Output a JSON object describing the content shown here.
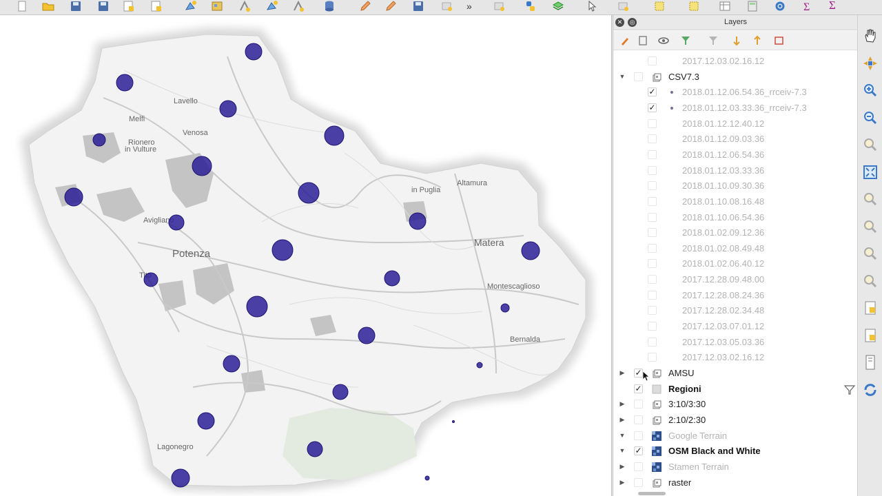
{
  "toolbar": {
    "icons": [
      "new-project-icon",
      "open-project-icon",
      "save-project-icon",
      "save-as-icon",
      "new-print-layout-icon",
      "layout-manager-icon",
      "add-vector-layer-icon",
      "add-raster-layer-icon",
      "digitize-icon",
      "new-shapefile-icon",
      "add-delimited-text-icon",
      "add-database-icon",
      "edit-pencil-icon",
      "toggle-editing-icon",
      "save-edits-icon",
      "add-feature-icon",
      "more-tools-icon",
      "copy-features-icon",
      "python-icon",
      "add-plugin-icon",
      "identify-icon",
      "select-features-icon",
      "select-by-value-icon",
      "deselect-icon",
      "attribute-table-icon",
      "field-calculator-icon",
      "processing-toolbox-icon",
      "statistics-icon"
    ],
    "more_glyph": "»",
    "sigma_glyph": "Σ"
  },
  "map": {
    "labels": [
      {
        "key": "lavello",
        "text": "Lavello"
      },
      {
        "key": "melfi",
        "text": "Melfi"
      },
      {
        "key": "venosa",
        "text": "Venosa"
      },
      {
        "key": "rionero1",
        "text": "Rionero"
      },
      {
        "key": "rionero2",
        "text": "in Vulture"
      },
      {
        "key": "gravina",
        "text": "in Puglia"
      },
      {
        "key": "altamura",
        "text": "Altamura"
      },
      {
        "key": "matera",
        "text": "Matera"
      },
      {
        "key": "avigliano",
        "text": "Avigliano"
      },
      {
        "key": "potenza",
        "text": "Potenza"
      },
      {
        "key": "tito",
        "text": "Tito"
      },
      {
        "key": "montescaglioso",
        "text": "Montescaglioso"
      },
      {
        "key": "bernalda",
        "text": "Bernalda"
      },
      {
        "key": "lagonegro",
        "text": "Lagonegro"
      }
    ],
    "point_color": "#2a1f96"
  },
  "layers_panel": {
    "title": "Layers",
    "tools": [
      "style-brush-icon",
      "add-group-icon",
      "manage-visibility-icon",
      "filter-legend-icon",
      "filter-expression-icon",
      "expand-all-icon",
      "collapse-all-icon",
      "remove-layer-icon"
    ],
    "rows": [
      {
        "label": "2017.12.03.02.16.12",
        "level": 2,
        "style": "dim",
        "checked": false,
        "arrow": "",
        "icon": "",
        "dot": false
      },
      {
        "label": "CSV7.3",
        "level": 1,
        "style": "normal",
        "checked": false,
        "arrow": "▼",
        "icon": "group",
        "dot": false
      },
      {
        "label": "2018.01.12.06.54.36_rrceiv-7.3",
        "level": 2,
        "style": "dim",
        "checked": true,
        "arrow": "",
        "icon": "",
        "dot": true
      },
      {
        "label": "2018.01.12.03.33.36_rrceiv-7.3",
        "level": 2,
        "style": "dim",
        "checked": true,
        "arrow": "",
        "icon": "",
        "dot": true
      },
      {
        "label": "2018.01.12.12.40.12",
        "level": 2,
        "style": "dim",
        "checked": false,
        "arrow": "",
        "icon": "",
        "dot": false
      },
      {
        "label": "2018.01.12.09.03.36",
        "level": 2,
        "style": "dim",
        "checked": false,
        "arrow": "",
        "icon": "",
        "dot": false
      },
      {
        "label": "2018.01.12.06.54.36",
        "level": 2,
        "style": "dim",
        "checked": false,
        "arrow": "",
        "icon": "",
        "dot": false
      },
      {
        "label": "2018.01.12.03.33.36",
        "level": 2,
        "style": "dim",
        "checked": false,
        "arrow": "",
        "icon": "",
        "dot": false
      },
      {
        "label": "2018.01.10.09.30.36",
        "level": 2,
        "style": "dim",
        "checked": false,
        "arrow": "",
        "icon": "",
        "dot": false
      },
      {
        "label": "2018.01.10.08.16.48",
        "level": 2,
        "style": "dim",
        "checked": false,
        "arrow": "",
        "icon": "",
        "dot": false
      },
      {
        "label": "2018.01.10.06.54.36",
        "level": 2,
        "style": "dim",
        "checked": false,
        "arrow": "",
        "icon": "",
        "dot": false
      },
      {
        "label": "2018.01.02.09.12.36",
        "level": 2,
        "style": "dim",
        "checked": false,
        "arrow": "",
        "icon": "",
        "dot": false
      },
      {
        "label": "2018.01.02.08.49.48",
        "level": 2,
        "style": "dim",
        "checked": false,
        "arrow": "",
        "icon": "",
        "dot": false
      },
      {
        "label": "2018.01.02.06.40.12",
        "level": 2,
        "style": "dim",
        "checked": false,
        "arrow": "",
        "icon": "",
        "dot": false
      },
      {
        "label": "2017.12.28.09.48.00",
        "level": 2,
        "style": "dim",
        "checked": false,
        "arrow": "",
        "icon": "",
        "dot": false
      },
      {
        "label": "2017.12.28.08.24.36",
        "level": 2,
        "style": "dim",
        "checked": false,
        "arrow": "",
        "icon": "",
        "dot": false
      },
      {
        "label": "2017.12.28.02.34.48",
        "level": 2,
        "style": "dim",
        "checked": false,
        "arrow": "",
        "icon": "",
        "dot": false
      },
      {
        "label": "2017.12.03.07.01.12",
        "level": 2,
        "style": "dim",
        "checked": false,
        "arrow": "",
        "icon": "",
        "dot": false
      },
      {
        "label": "2017.12.03.05.03.36",
        "level": 2,
        "style": "dim",
        "checked": false,
        "arrow": "",
        "icon": "",
        "dot": false
      },
      {
        "label": "2017.12.03.02.16.12",
        "level": 2,
        "style": "dim",
        "checked": false,
        "arrow": "",
        "icon": "",
        "dot": false
      },
      {
        "label": "AMSU",
        "level": 1,
        "style": "normal",
        "checked": true,
        "arrow": "▶",
        "icon": "group",
        "dot": false
      },
      {
        "label": "Regioni",
        "level": 1,
        "style": "bold",
        "checked": true,
        "arrow": "",
        "icon": "polygon",
        "dot": false
      },
      {
        "label": "3:10/3:30",
        "level": 1,
        "style": "normal",
        "checked": false,
        "arrow": "▶",
        "icon": "group",
        "dot": false
      },
      {
        "label": "2:10/2:30",
        "level": 1,
        "style": "normal",
        "checked": false,
        "arrow": "▶",
        "icon": "group",
        "dot": false
      },
      {
        "label": "Google Terrain",
        "level": 1,
        "style": "dim",
        "checked": false,
        "arrow": "▼",
        "icon": "raster",
        "dot": false
      },
      {
        "label": "OSM Black and White",
        "level": 1,
        "style": "bold",
        "checked": true,
        "arrow": "▼",
        "icon": "raster",
        "dot": false
      },
      {
        "label": "Stamen Terrain",
        "level": 1,
        "style": "dim",
        "checked": false,
        "arrow": "▶",
        "icon": "raster",
        "dot": false
      },
      {
        "label": "raster",
        "level": 1,
        "style": "normal",
        "checked": false,
        "arrow": "▶",
        "icon": "group",
        "dot": false
      }
    ],
    "check_glyph": "✓"
  },
  "right_toolbar": {
    "icons": [
      "pan-hand-icon",
      "pan-to-selection-icon",
      "zoom-in-icon",
      "zoom-out-icon",
      "zoom-native-icon",
      "zoom-full-icon",
      "zoom-to-selection-icon",
      "zoom-to-layer-icon",
      "zoom-last-icon",
      "zoom-next-icon",
      "new-bookmark-icon",
      "show-bookmarks-icon",
      "tile-scale-icon",
      "refresh-icon"
    ]
  }
}
